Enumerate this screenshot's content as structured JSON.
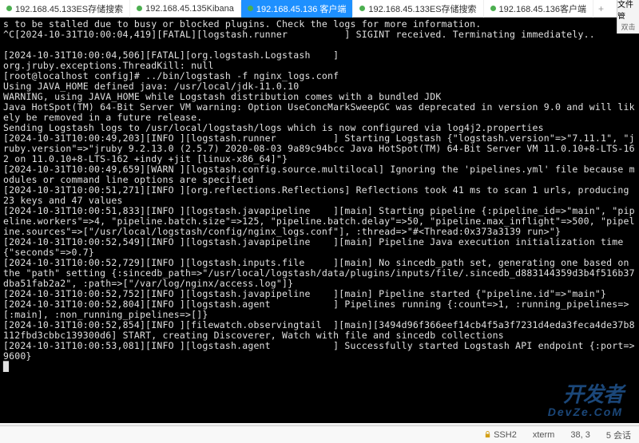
{
  "tabs": [
    {
      "label": "192.168.45.133ES存储搜索",
      "active": false
    },
    {
      "label": "192.168.45.135Kibana",
      "active": false
    },
    {
      "label": "192.168.45.136 客户端",
      "active": true
    },
    {
      "label": "192.168.45.133ES存储搜索",
      "active": false
    },
    {
      "label": "192.168.45.136客户端",
      "active": false
    }
  ],
  "side_labels": {
    "files": "文件管",
    "diff": "双击"
  },
  "terminal_lines": [
    "s to be stalled due to busy or blocked plugins. Check the logs for more information.",
    "^C[2024-10-31T10:00:04,419][FATAL][logstash.runner          ] SIGINT received. Terminating immediately..",
    "",
    "[2024-10-31T10:00:04,506][FATAL][org.logstash.Logstash    ]",
    "org.jruby.exceptions.ThreadKill: null",
    "[root@localhost config]# ../bin/logstash -f nginx_logs.conf",
    "Using JAVA_HOME defined java: /usr/local/jdk-11.0.10",
    "WARNING, using JAVA_HOME while Logstash distribution comes with a bundled JDK",
    "Java HotSpot(TM) 64-Bit Server VM warning: Option UseConcMarkSweepGC was deprecated in version 9.0 and will likely be removed in a future release.",
    "Sending Logstash logs to /usr/local/logstash/logs which is now configured via log4j2.properties",
    "[2024-10-31T10:00:49,203][INFO ][logstash.runner          ] Starting Logstash {\"logstash.version\"=>\"7.11.1\", \"jruby.version\"=>\"jruby 9.2.13.0 (2.5.7) 2020-08-03 9a89c94bcc Java HotSpot(TM) 64-Bit Server VM 11.0.10+8-LTS-162 on 11.0.10+8-LTS-162 +indy +jit [linux-x86_64]\"}",
    "[2024-10-31T10:00:49,659][WARN ][logstash.config.source.multilocal] Ignoring the 'pipelines.yml' file because modules or command line options are specified",
    "[2024-10-31T10:00:51,271][INFO ][org.reflections.Reflections] Reflections took 41 ms to scan 1 urls, producing 23 keys and 47 values",
    "[2024-10-31T10:00:51,833][INFO ][logstash.javapipeline    ][main] Starting pipeline {:pipeline_id=>\"main\", \"pipeline.workers\"=>4, \"pipeline.batch.size\"=>125, \"pipeline.batch.delay\"=>50, \"pipeline.max_inflight\"=>500, \"pipeline.sources\"=>[\"/usr/local/logstash/config/nginx_logs.conf\"], :thread=>\"#<Thread:0x373a3139 run>\"}",
    "[2024-10-31T10:00:52,549][INFO ][logstash.javapipeline    ][main] Pipeline Java execution initialization time {\"seconds\"=>0.7}",
    "[2024-10-31T10:00:52,729][INFO ][logstash.inputs.file     ][main] No sincedb_path set, generating one based on the \"path\" setting {:sincedb_path=>\"/usr/local/logstash/data/plugins/inputs/file/.sincedb_d883144359d3b4f516b37dba51fab2a2\", :path=>[\"/var/log/nginx/access.log\"]}",
    "[2024-10-31T10:00:52,752][INFO ][logstash.javapipeline    ][main] Pipeline started {\"pipeline.id\"=>\"main\"}",
    "[2024-10-31T10:00:52,804][INFO ][logstash.agent           ] Pipelines running {:count=>1, :running_pipelines=>[:main], :non_running_pipelines=>[]}",
    "[2024-10-31T10:00:52,854][INFO ][filewatch.observingtail  ][main][3494d96f366eef14cb4f5a3f7231d4eda3feca4de37b8112fbd3cbbc139300d6] START, creating Discoverer, Watch with file and sincedb collections",
    "[2024-10-31T10:00:53,081][INFO ][logstash.agent           ] Successfully started Logstash API endpoint {:port=>9600}",
    ""
  ],
  "status": {
    "ssh": "SSH2",
    "term": "xterm",
    "pos": "38, 3",
    "sessions": "5 会话"
  },
  "watermark": {
    "line1": "开发者",
    "line2": "DevZe.CoM"
  },
  "cursor": "█"
}
